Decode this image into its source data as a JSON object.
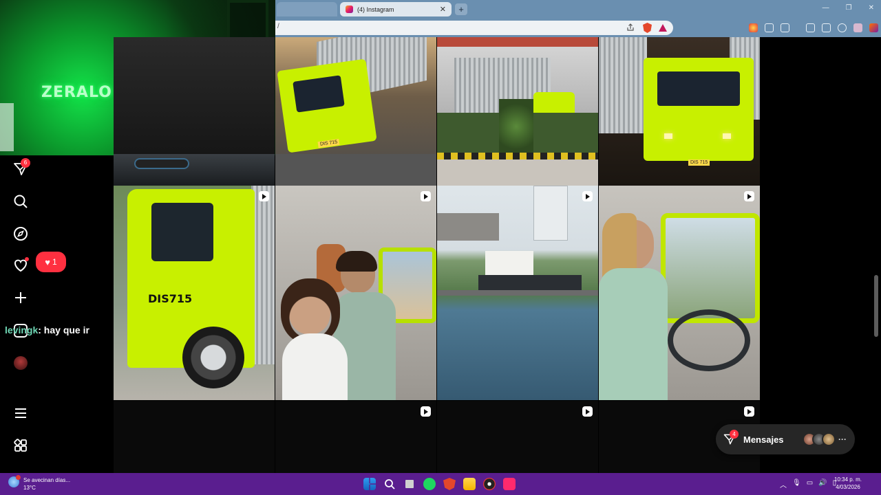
{
  "browser": {
    "active_tab_title": "(4) Instagram",
    "new_tab_label": "+",
    "window_controls": {
      "minimize": "—",
      "maximize": "❐",
      "close": "✕"
    },
    "url_fragment": "/"
  },
  "sidebar": {
    "messages_badge": "6",
    "notifications_badge": "1"
  },
  "chat_overlay": {
    "username": "levingk",
    "message": ": hay que ir"
  },
  "grid": {
    "tiles": [
      {
        "plate": "DIS 715",
        "reel": false
      },
      {
        "reel": false
      },
      {
        "plate": "DIS 715",
        "reel": false
      },
      {
        "text": "DIS715",
        "reel": true
      },
      {
        "reel": true
      },
      {
        "reel": true
      },
      {
        "reel": true
      },
      {
        "reel": true
      },
      {
        "reel": true
      },
      {
        "reel": true
      },
      {
        "reel": true
      }
    ]
  },
  "messages_button": {
    "label": "Mensajes",
    "badge": "4",
    "more": "···"
  },
  "taskbar": {
    "weather_text": "Se avecinan días...",
    "temperature": "13°C",
    "time": "10:34 p. m.",
    "date": "4/03/2026"
  },
  "colors": {
    "titlebar": "#6a8fb0",
    "taskbar": "#5a1e8f",
    "notification_red": "#ff3040",
    "truck_green": "#c8f000"
  }
}
